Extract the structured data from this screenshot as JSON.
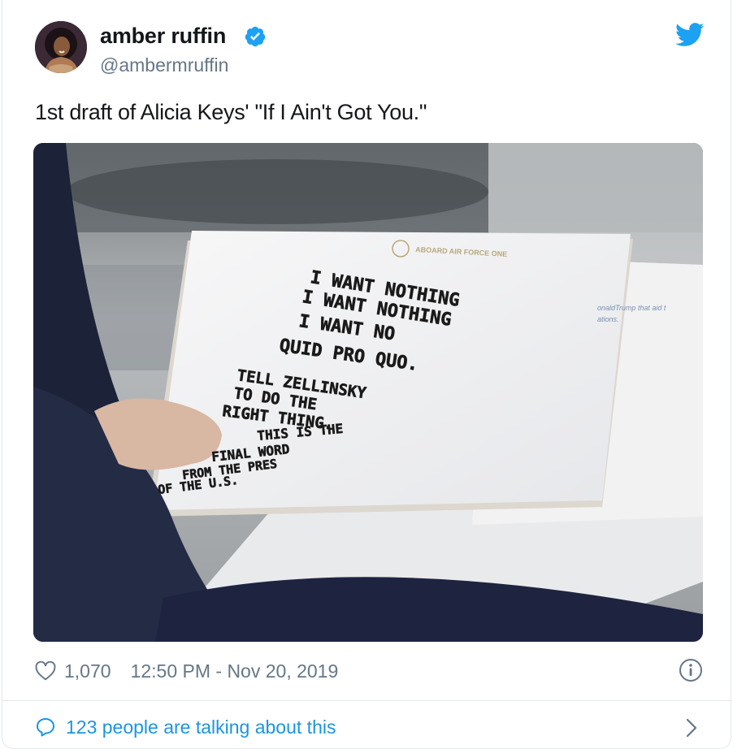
{
  "tweet": {
    "display_name": "amber ruffin",
    "handle": "@ambermruffin",
    "text": "1st draft of Alicia Keys' \"If I Ain't Got You.\"",
    "verified": true
  },
  "media": {
    "notepad_header": "ABOARD AIR FORCE ONE",
    "handwritten_lines": [
      "I WANT NOTHING",
      "I WANT NOTHING",
      "I WANT NO",
      "QUID PRO QUO.",
      "TELL ZELLINSKY",
      "TO DO THE",
      "RIGHT THING.",
      "THIS IS THE",
      "FINAL WORD",
      "FROM THE PRES",
      "OF THE U.S."
    ],
    "background_paper_text": [
      "onaldTrump that aid t",
      "ations."
    ]
  },
  "footer": {
    "likes": "1,070",
    "timestamp": "12:50 PM - Nov 20, 2019",
    "talking": "123 people are talking about this"
  },
  "icons": {
    "verified": "verified-badge-icon",
    "bird": "twitter-bird-icon",
    "heart": "heart-icon",
    "info": "info-icon",
    "bubble": "comment-bubble-icon",
    "chevron": "chevron-right-icon"
  },
  "colors": {
    "twitter_blue": "#1da1f2",
    "link_blue": "#1b95e0",
    "secondary_text": "#657786",
    "verified_blue": "#1da1f2"
  }
}
